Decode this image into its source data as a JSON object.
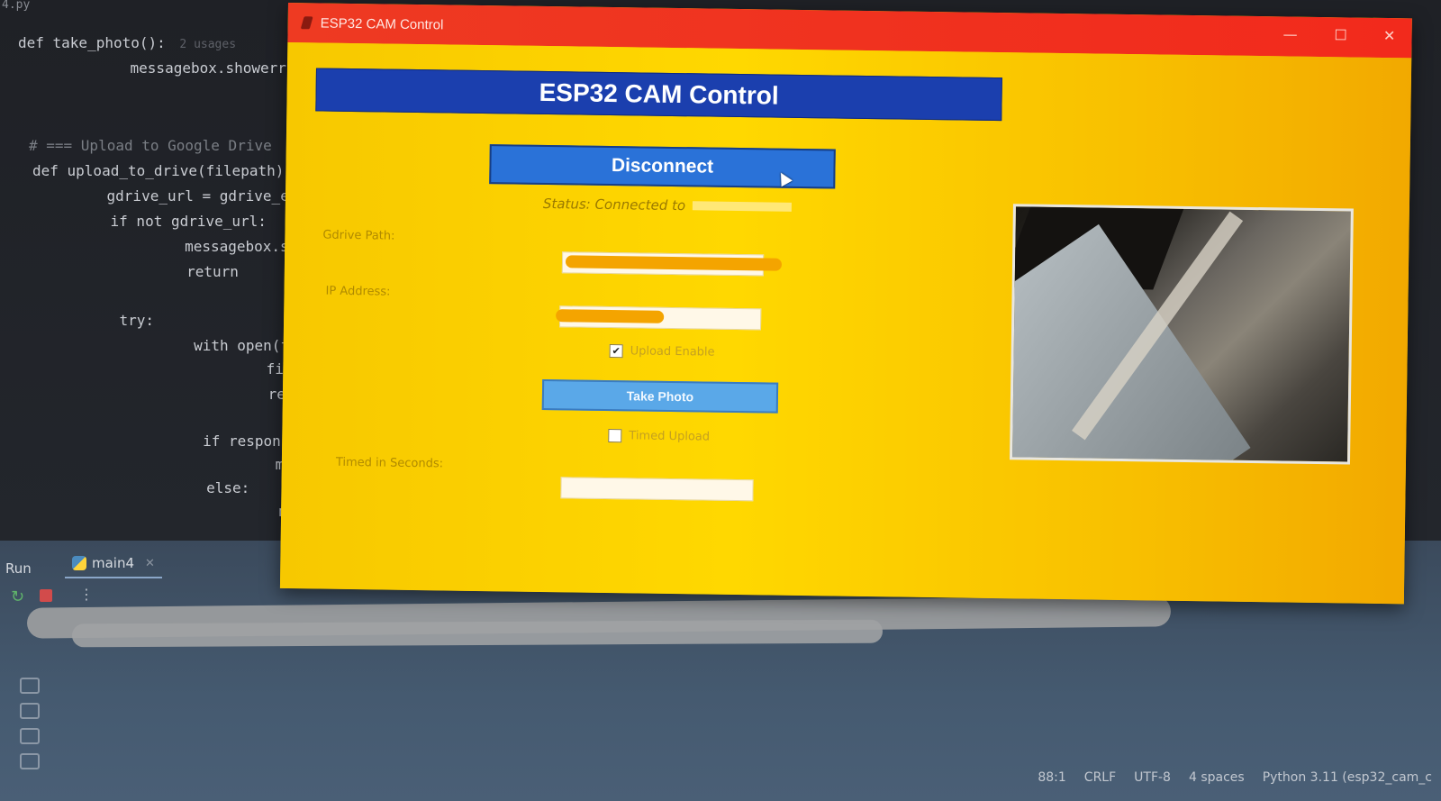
{
  "ide": {
    "file_label": "4.py",
    "code_lines": [
      {
        "text": "def take_photo():",
        "hint": "2 usages"
      },
      {
        "text": "    messagebox.showerror("
      },
      {
        "text": ""
      },
      {
        "text": "# === Upload to Google Drive"
      },
      {
        "text": "def upload_to_drive(filepath)"
      },
      {
        "text": "    gdrive_url = gdrive_entry"
      },
      {
        "text": "    if not gdrive_url:"
      },
      {
        "text": "        messagebox.showerror("
      },
      {
        "text": "        return"
      },
      {
        "text": ""
      },
      {
        "text": "    try:"
      },
      {
        "text": "        with open(filepath, '"
      },
      {
        "text": "            files = {'file':"
      },
      {
        "text": "            response = reques"
      },
      {
        "text": ""
      },
      {
        "text": "        if response.status_co"
      },
      {
        "text": "            messagebox.showin"
      },
      {
        "text": "        else:"
      },
      {
        "text": "            messagebox.shower"
      }
    ],
    "run_panel": {
      "label": "Run",
      "tab_label": "main4"
    },
    "status_bar": [
      "88:1",
      "CRLF",
      "UTF-8",
      "4 spaces",
      "Python 3.11 (esp32_cam_c"
    ]
  },
  "app": {
    "window_title": "ESP32 CAM Control",
    "header": "ESP32 CAM Control",
    "disconnect_label": "Disconnect",
    "status_text": "Status: Connected to",
    "gdrive_label": "Gdrive Path:",
    "ip_label": "IP Address:",
    "upload_enable_label": "Upload Enable",
    "upload_enable_checked": true,
    "take_photo_label": "Take Photo",
    "timed_upload_label": "Timed Upload",
    "timed_upload_checked": false,
    "timed_seconds_label": "Timed in Seconds:",
    "timed_seconds_value": "",
    "colors": {
      "window_bg": "#f7cc00",
      "titlebar": "#f02e1e",
      "header_bg": "#1b3fae",
      "disconnect_bg": "#2a72d8",
      "take_photo_bg": "#5aa8e8"
    }
  }
}
